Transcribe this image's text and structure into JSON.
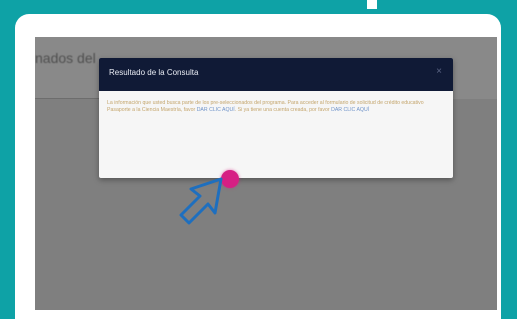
{
  "background": {
    "heading": "nados del                          "
  },
  "modal": {
    "title": "Resultado de la Consulta",
    "close_glyph": "×",
    "body_text_1": "La información que usted busca parte de los pre-seleccionados del programa. Para acceder al formulario de solicitud de crédito educativo Pasaporte a la Ciencia Maestría, favor",
    "link_1": "DAR CLIC AQUÍ",
    "body_text_2": ". Si ya tiene una cuenta creada, por favor",
    "link_2": "DAR CLIC AQUÍ"
  },
  "colors": {
    "outer_bg": "#0ea2a6",
    "frame": "#ffffff",
    "screen_dim": "#7f7f7f",
    "modal_header": "#101a36",
    "cursor_accent": "#d61f84",
    "arrow_stroke": "#1e6fbf"
  },
  "icons": {
    "cursor": "pointer-arrow-icon",
    "click": "click-indicator-icon",
    "close": "close-icon"
  }
}
